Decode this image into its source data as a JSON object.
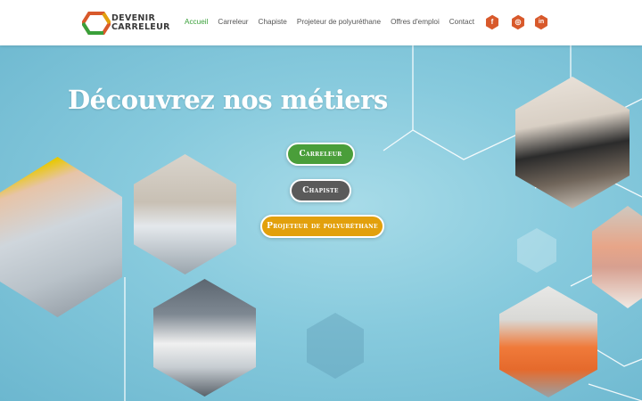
{
  "brand": {
    "line1": "DEVENIR",
    "line2": "CARRELEUR"
  },
  "nav": {
    "items": [
      {
        "label": "Accueil",
        "active": true
      },
      {
        "label": "Carreleur",
        "active": false
      },
      {
        "label": "Chapiste",
        "active": false
      },
      {
        "label": "Projeteur de polyuréthane",
        "active": false
      },
      {
        "label": "Offres d'emploi",
        "active": false
      },
      {
        "label": "Contact",
        "active": false
      }
    ]
  },
  "social": [
    {
      "icon": "facebook-icon",
      "glyph": "f"
    },
    {
      "icon": "instagram-icon",
      "glyph": "◎"
    },
    {
      "icon": "linkedin-icon",
      "glyph": "in"
    }
  ],
  "hero": {
    "title": "Découvrez nos métiers",
    "buttons": [
      {
        "label": "Carreleur",
        "color": "#4a9e3a"
      },
      {
        "label": "Chapiste",
        "color": "#5a5a5a"
      },
      {
        "label": "Projeteur de polyuréthane",
        "color": "#e2a00c"
      }
    ]
  },
  "colors": {
    "accent_green": "#3aa03a",
    "social": "#d8592b",
    "hero_bg": "#87cadd"
  }
}
